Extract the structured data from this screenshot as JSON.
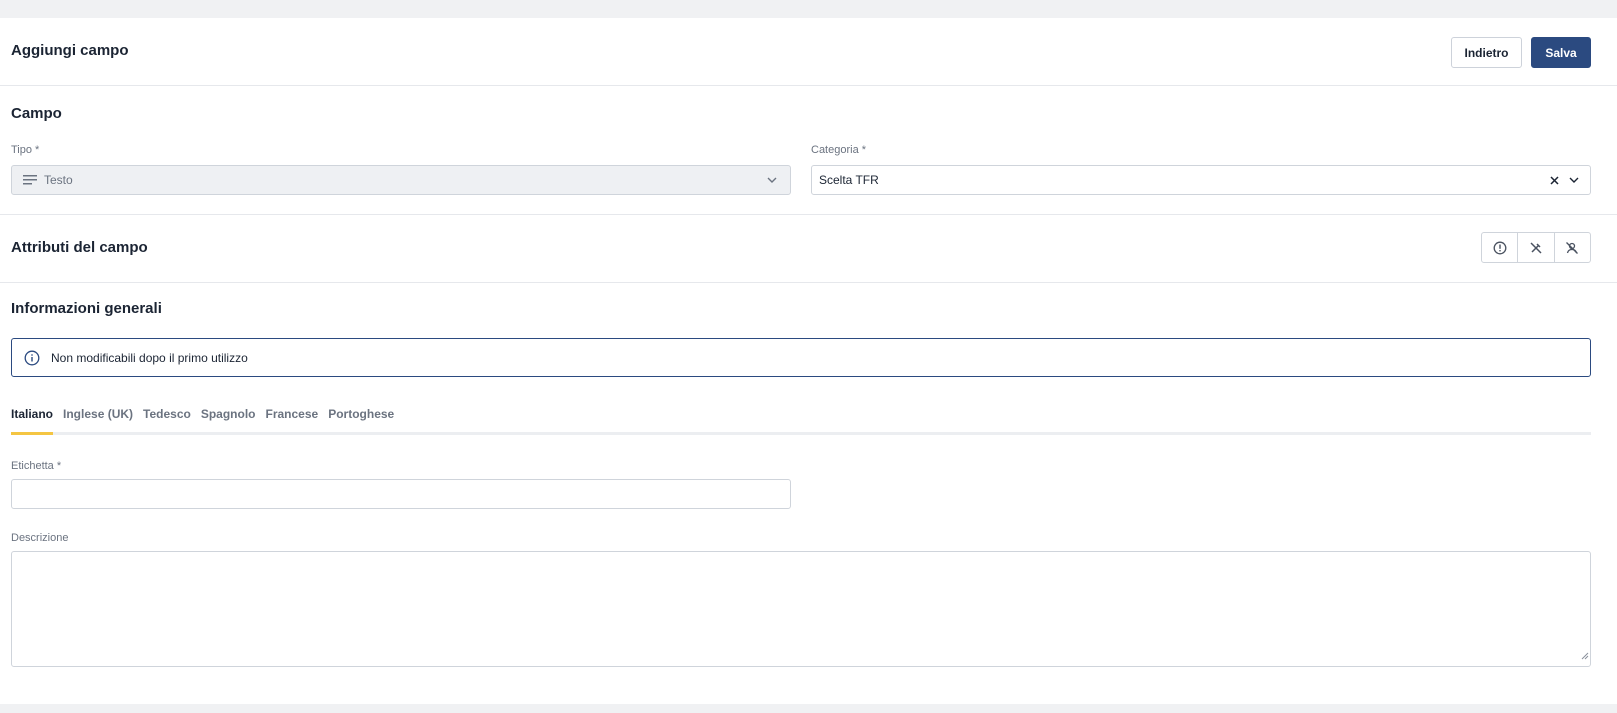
{
  "header": {
    "title": "Aggiungi campo",
    "back_label": "Indietro",
    "save_label": "Salva"
  },
  "campo": {
    "title": "Campo",
    "tipo": {
      "label": "Tipo *",
      "value": "Testo",
      "icon": "text-lines-icon"
    },
    "categoria": {
      "label": "Categoria *",
      "value": "Scelta TFR"
    }
  },
  "attributi": {
    "title": "Attributi del campo",
    "icons": [
      "required-alert-icon",
      "no-edit-icon",
      "no-user-icon"
    ]
  },
  "info": {
    "title": "Informazioni generali",
    "alert_text": "Non modificabili dopo il primo utilizzo",
    "tabs": [
      "Italiano",
      "Inglese (UK)",
      "Tedesco",
      "Spagnolo",
      "Francese",
      "Portoghese"
    ],
    "active_tab": "Italiano",
    "etichetta_label": "Etichetta *",
    "etichetta_value": "",
    "descrizione_label": "Descrizione",
    "descrizione_value": ""
  },
  "colors": {
    "primary": "#2b4a80",
    "tab_accent": "#f4c542",
    "background": "#f0f1f3"
  }
}
